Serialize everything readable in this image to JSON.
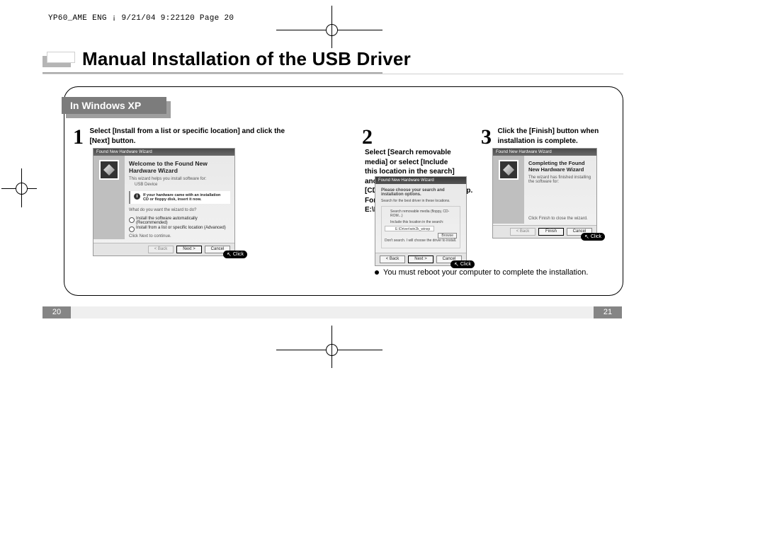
{
  "print_header": "YP60_AME ENG ¡   9/21/04 9:22120   Page 20",
  "page_title": "Manual Installation of the USB Driver",
  "section_tab": "In Windows XP",
  "steps": {
    "s1": {
      "num": "1",
      "text": "Select [Install from a list or specific location] and click the [Next] button."
    },
    "s2": {
      "num": "2",
      "text": "Select [Search removable media] or select [Include this location in the search] and designate [CDROM]:\\Drivers\\win2k_winxp. For example E:\\Driver\\win2k_winxp."
    },
    "s3": {
      "num": "3",
      "text": "Click the [Finish] button when installation is complete."
    }
  },
  "wizard1": {
    "titlebar": "Found New Hardware Wizard",
    "heading": "Welcome to the Found New Hardware Wizard",
    "sub": "This wizard helps you install software for:",
    "device": "USB Device",
    "note": "If your hardware came with an installation CD or floppy disk, insert it now.",
    "prompt": "What do you want the wizard to do?",
    "radio1": "Install the software automatically (Recommended)",
    "radio2": "Install from a list or specific location (Advanced)",
    "cont": "Click Next to continue.",
    "btn_back": "< Back",
    "btn_next": "Next >",
    "btn_cancel": "Cancel",
    "click": "Click"
  },
  "wizard2": {
    "titlebar": "Found New Hardware Wizard",
    "heading": "Please choose your search and installation options.",
    "opt1": "Search for the best driver in these locations.",
    "chk1": "Search removable media (floppy, CD-ROM...)",
    "chk2": "Include this location in the search:",
    "path": "E:\\Driver\\win2k_winxp",
    "browse": "Browse",
    "opt2": "Don't search. I will choose the driver to install.",
    "btn_back": "< Back",
    "btn_next": "Next >",
    "btn_cancel": "Cancel",
    "click": "Click"
  },
  "wizard3": {
    "titlebar": "Found New Hardware Wizard",
    "heading": "Completing the Found New Hardware Wizard",
    "sub": "The wizard has finished installing the software for:",
    "close": "Click Finish to close the wizard.",
    "btn_back": "< Back",
    "btn_finish": "Finish",
    "btn_cancel": "Cancel",
    "click": "Click"
  },
  "reboot_note": "You must reboot your computer to complete the installation.",
  "page_num_left": "20",
  "page_num_right": "21"
}
